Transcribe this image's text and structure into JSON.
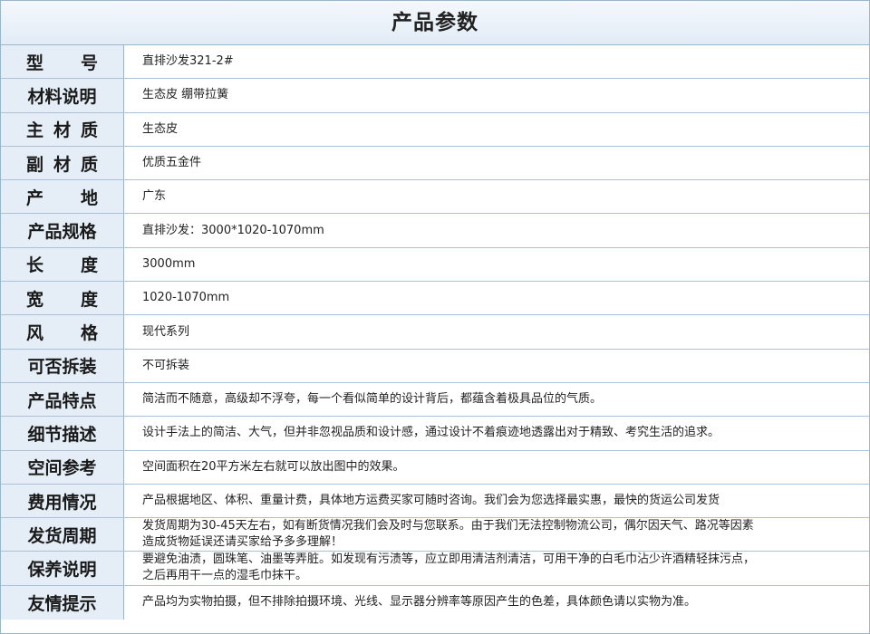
{
  "title": "产品参数",
  "rows": [
    {
      "label": "型号",
      "chars": [
        "型",
        "号"
      ],
      "value": [
        "直排沙发321-2#"
      ]
    },
    {
      "label": "材料说明",
      "value": [
        "生态皮 绷带拉簧"
      ]
    },
    {
      "label": "主材质",
      "chars": [
        "主",
        "材",
        "质"
      ],
      "value": [
        "生态皮"
      ]
    },
    {
      "label": "副材质",
      "chars": [
        "副",
        "材",
        "质"
      ],
      "value": [
        "优质五金件"
      ]
    },
    {
      "label": "产地",
      "chars": [
        "产",
        "地"
      ],
      "value": [
        "广东"
      ]
    },
    {
      "label": "产品规格",
      "value": [
        "直排沙发：3000*1020-1070mm"
      ]
    },
    {
      "label": "长度",
      "chars": [
        "长",
        "度"
      ],
      "value": [
        "3000mm"
      ]
    },
    {
      "label": "宽度",
      "chars": [
        "宽",
        "度"
      ],
      "value": [
        "1020-1070mm"
      ]
    },
    {
      "label": "风格",
      "chars": [
        "风",
        "格"
      ],
      "value": [
        "现代系列"
      ]
    },
    {
      "label": "可否拆装",
      "value": [
        "不可拆装"
      ]
    },
    {
      "label": "产品特点",
      "value": [
        "简洁而不随意，高级却不浮夸，每一个看似简单的设计背后，都蕴含着极具品位的气质。"
      ]
    },
    {
      "label": "细节描述",
      "value": [
        "设计手法上的简洁、大气，但并非忽视品质和设计感，通过设计不着痕迹地透露出对于精致、考究生活的追求。"
      ]
    },
    {
      "label": "空间参考",
      "value": [
        "空间面积在20平方米左右就可以放出图中的效果。"
      ]
    },
    {
      "label": "费用情况",
      "value": [
        "产品根据地区、体积、重量计费，具体地方运费买家可随时咨询。我们会为您选择最实惠，最快的货运公司发货"
      ]
    },
    {
      "label": "发货周期",
      "value": [
        "发货周期为30-45天左右，如有断货情况我们会及时与您联系。由于我们无法控制物流公司，偶尔因天气、路况等因素",
        "造成货物延误还请买家给予多多理解！"
      ]
    },
    {
      "label": "保养说明",
      "value": [
        "要避免油渍，圆珠笔、油墨等弄脏。如发现有污渍等，应立即用清洁剂清洁，可用干净的白毛巾沾少许酒精轻抹污点，",
        "之后再用干一点的湿毛巾抹干。"
      ]
    },
    {
      "label": "友情提示",
      "value": [
        "产品均为实物拍摄，但不排除拍摄环境、光线、显示器分辨率等原因产生的色差，具体颜色请以实物为准。"
      ]
    }
  ]
}
